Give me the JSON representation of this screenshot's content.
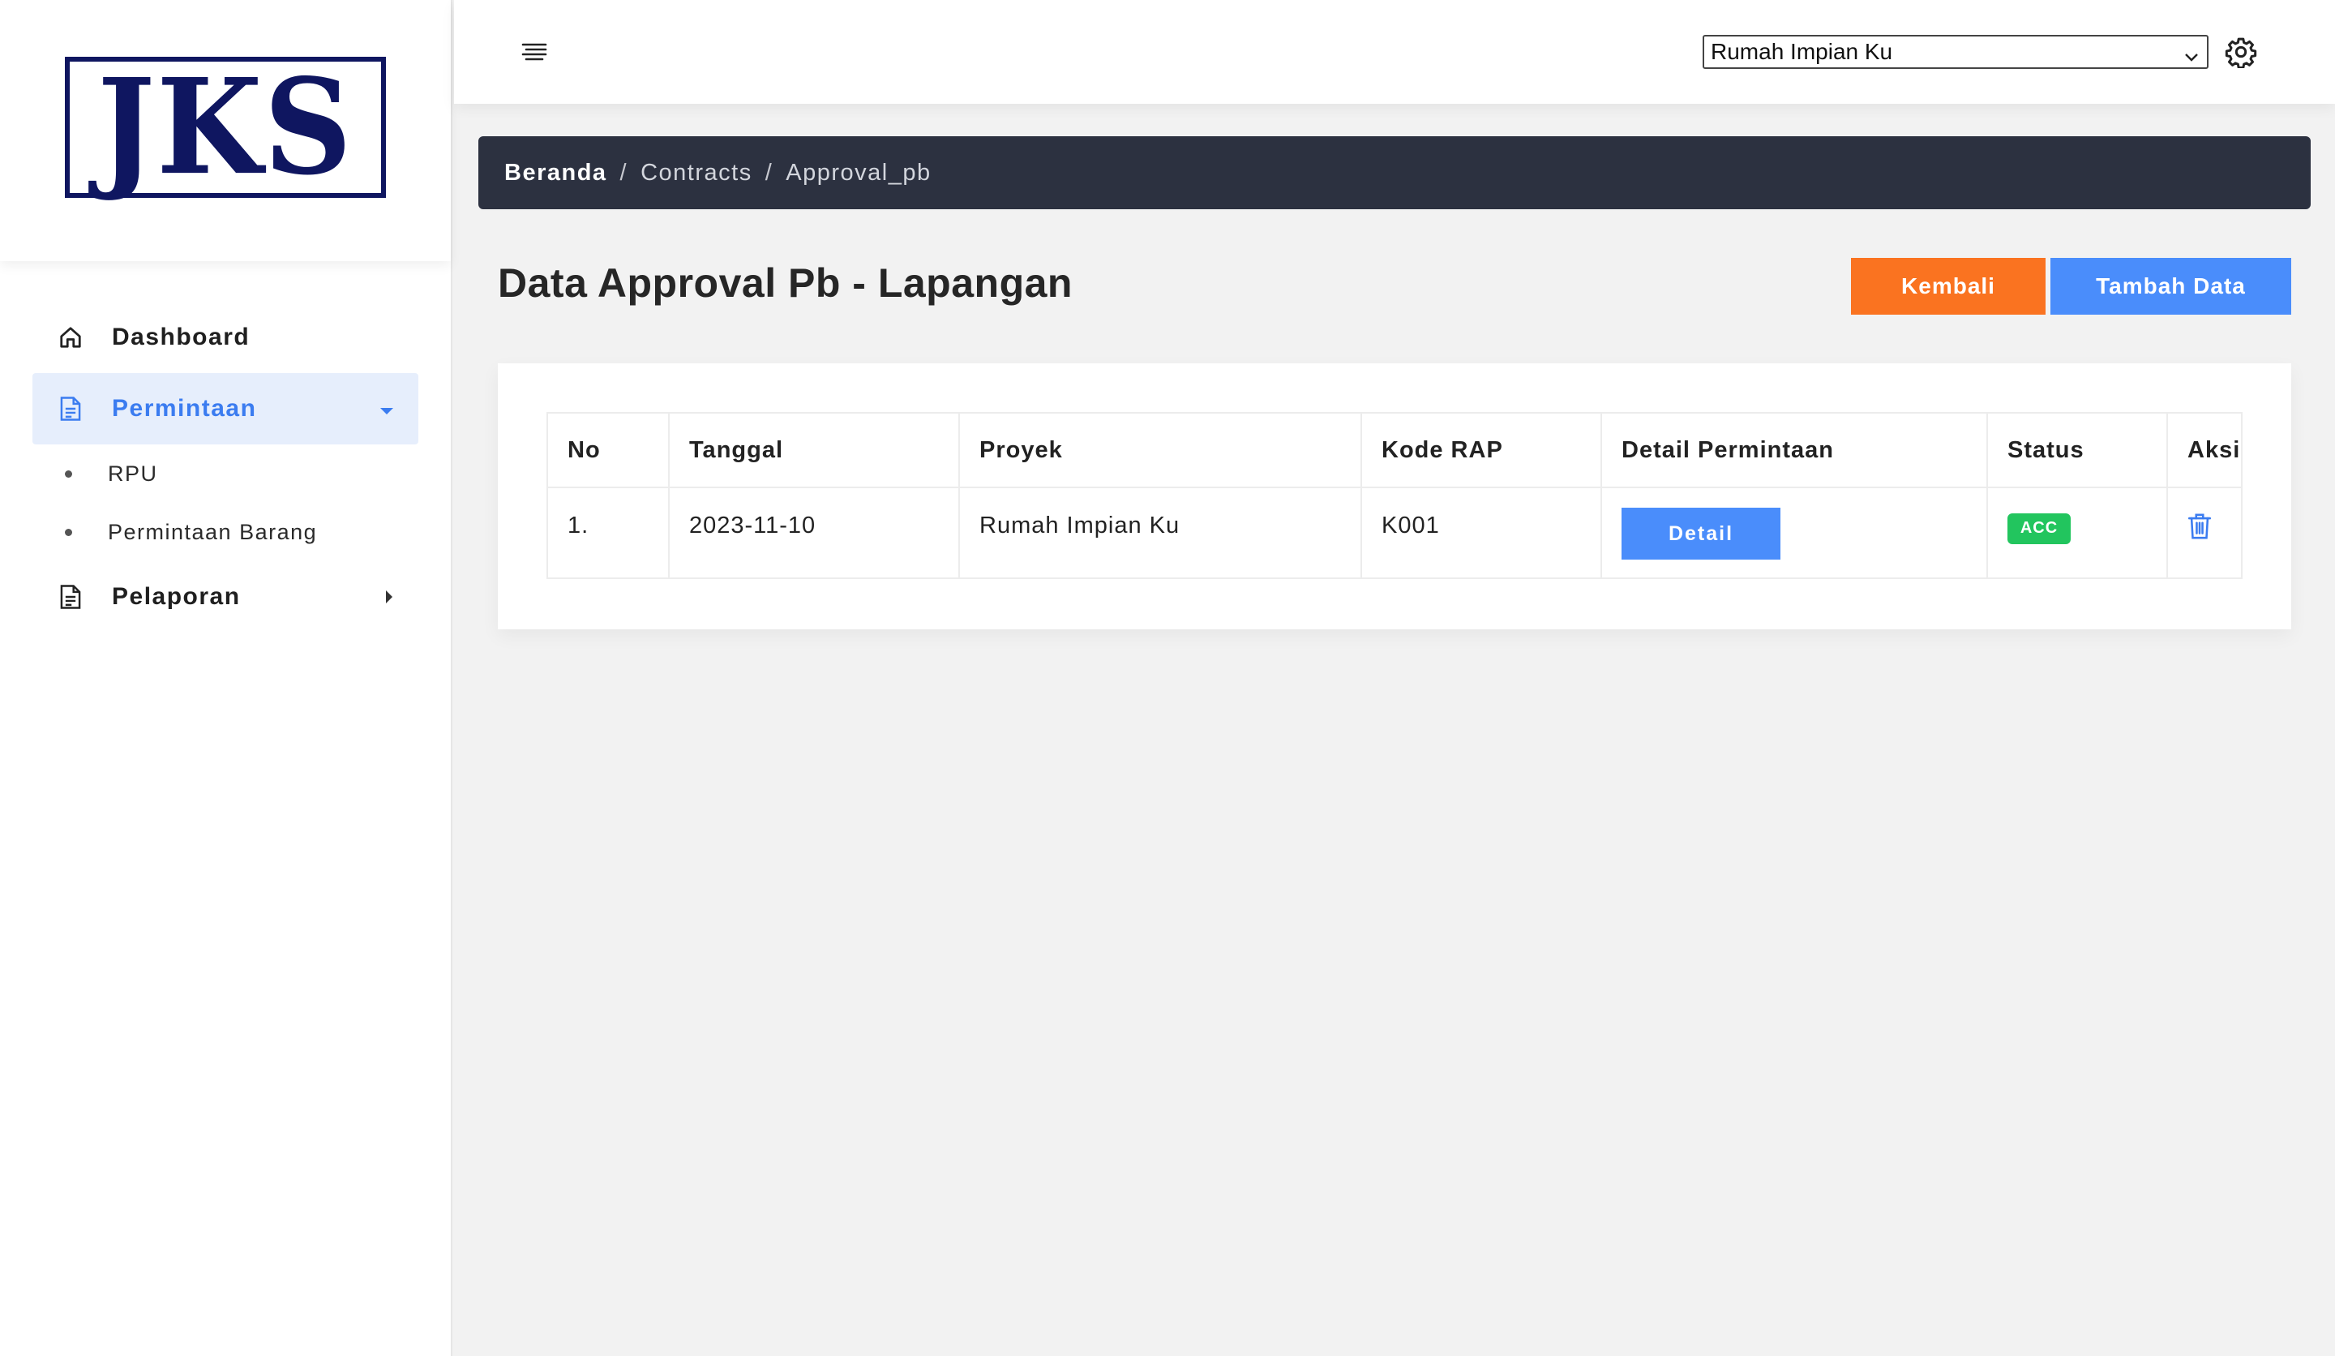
{
  "brand": {
    "logo_text": "JKS"
  },
  "sidebar": {
    "items": [
      {
        "label": "Dashboard",
        "icon": "home-icon"
      },
      {
        "label": "Permintaan",
        "icon": "document-icon",
        "active": true,
        "children": [
          {
            "label": "RPU"
          },
          {
            "label": "Permintaan Barang"
          }
        ]
      },
      {
        "label": "Pelaporan",
        "icon": "document-icon"
      }
    ]
  },
  "topbar": {
    "project_select": {
      "value": "Rumah Impian Ku"
    }
  },
  "breadcrumb": {
    "home": "Beranda",
    "sep": "/",
    "items": [
      "Contracts",
      "Approval_pb"
    ]
  },
  "page": {
    "title": "Data Approval Pb - Lapangan",
    "buttons": {
      "back": "Kembali",
      "add": "Tambah Data"
    }
  },
  "table": {
    "headers": [
      "No",
      "Tanggal",
      "Proyek",
      "Kode RAP",
      "Detail Permintaan",
      "Status",
      "Aksi"
    ],
    "rows": [
      {
        "no": "1.",
        "tanggal": "2023-11-10",
        "proyek": "Rumah Impian Ku",
        "kode_rap": "K001",
        "detail_label": "Detail",
        "status": "ACC"
      }
    ]
  },
  "colors": {
    "accent_blue": "#4a8dfb",
    "accent_orange": "#fa7320",
    "status_green": "#22c55e",
    "breadcrumb_bg": "#2c3140",
    "brand_navy": "#0f1660"
  }
}
